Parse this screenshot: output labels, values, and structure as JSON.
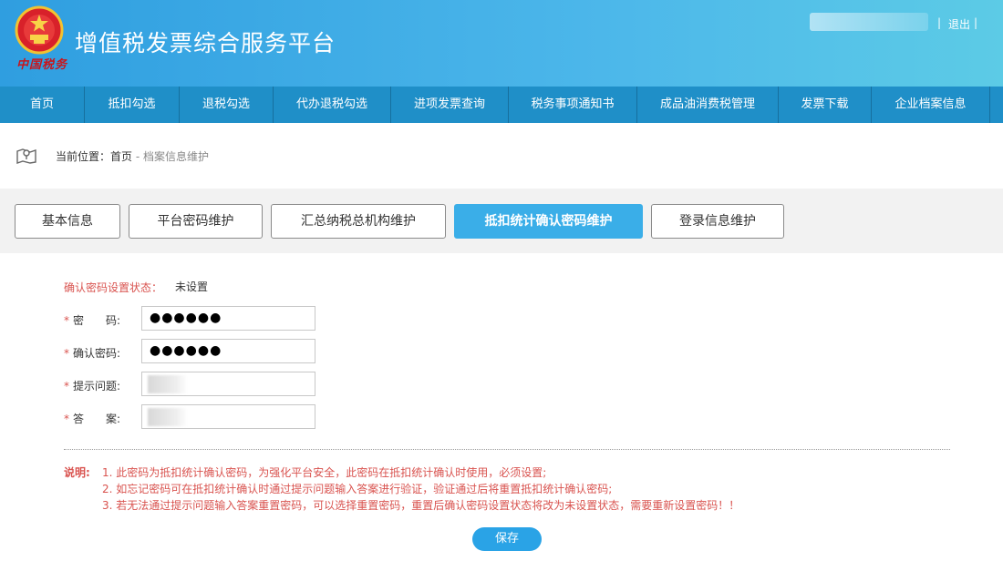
{
  "header": {
    "site_title": "增值税发票综合服务平台",
    "brand_script": "中国税务",
    "separator": "|",
    "logout_label": "退出"
  },
  "nav": {
    "items": [
      {
        "label": "首页"
      },
      {
        "label": "抵扣勾选"
      },
      {
        "label": "退税勾选"
      },
      {
        "label": "代办退税勾选"
      },
      {
        "label": "进项发票查询"
      },
      {
        "label": "税务事项通知书"
      },
      {
        "label": "成品油消费税管理"
      },
      {
        "label": "发票下载"
      },
      {
        "label": "企业档案信息"
      }
    ]
  },
  "breadcrumb": {
    "prefix": "当前位置：",
    "home": "首页",
    "separator": " - ",
    "current": "档案信息维护"
  },
  "tabs": {
    "items": [
      {
        "label": "基本信息"
      },
      {
        "label": "平台密码维护"
      },
      {
        "label": "汇总纳税总机构维护"
      },
      {
        "label": "抵扣统计确认密码维护"
      },
      {
        "label": "登录信息维护"
      }
    ],
    "active_index": 3
  },
  "form": {
    "status_label": "确认密码设置状态：",
    "status_value": "未设置",
    "required_mark": "*",
    "password_label": "密　　码:",
    "password_value": "●●●●●●",
    "confirm_label": "确认密码:",
    "confirm_value": "●●●●●●",
    "question_label": "提示问题:",
    "answer_label": "答　　案:"
  },
  "notes": {
    "title": "说明:",
    "lines": [
      "1. 此密码为抵扣统计确认密码，为强化平台安全，此密码在抵扣统计确认时使用，必须设置;",
      "2. 如忘记密码可在抵扣统计确认时通过提示问题输入答案进行验证，验证通过后将重置抵扣统计确认密码;",
      "3. 若无法通过提示问题输入答案重置密码，可以选择重置密码，重置后确认密码设置状态将改为未设置状态，需要重新设置密码！！"
    ]
  },
  "save_label": "保存",
  "colors": {
    "header_blue": "#2f9ee0",
    "nav_blue": "#1f8fc8",
    "active_tab": "#3aaee8",
    "warning_red": "#d9534f",
    "save_button": "#2aa3e6"
  }
}
